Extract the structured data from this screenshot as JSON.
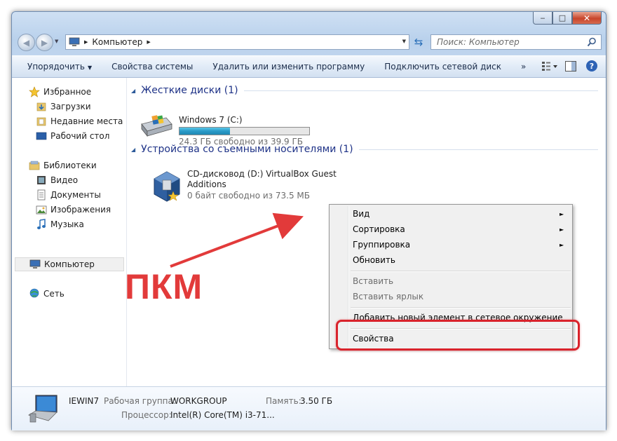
{
  "window": {
    "controls": {
      "minimize": "‒",
      "maximize": "□",
      "close": "✕"
    }
  },
  "navbar": {
    "address": "Компьютер",
    "search_placeholder": "Поиск: Компьютер"
  },
  "toolbar": {
    "organize": "Упорядочить",
    "system_properties": "Свойства системы",
    "uninstall": "Удалить или изменить программу",
    "map_drive": "Подключить сетевой диск",
    "more": "»"
  },
  "sidebar": {
    "favorites": {
      "label": "Избранное",
      "items": [
        "Загрузки",
        "Недавние места",
        "Рабочий стол"
      ]
    },
    "libraries": {
      "label": "Библиотеки",
      "items": [
        "Видео",
        "Документы",
        "Изображения",
        "Музыка"
      ]
    },
    "computer": "Компьютер",
    "network": "Сеть"
  },
  "main": {
    "hard_drives": {
      "header": "Жесткие диски (1)",
      "drive": {
        "name": "Windows 7 (C:)",
        "free": "24.3 ГБ свободно из 39.9 ГБ",
        "used_fraction": 0.39
      }
    },
    "removable": {
      "header": "Устройства со съемными носителями (1)",
      "drive": {
        "name_line1": "CD-дисковод (D:) VirtualBox Guest",
        "name_line2": "Additions",
        "free": "0 байт свободно из 73.5 МБ"
      }
    }
  },
  "context_menu": {
    "view": "Вид",
    "sort": "Сортировка",
    "group": "Группировка",
    "refresh": "Обновить",
    "paste": "Вставить",
    "paste_shortcut": "Вставить ярлык",
    "add_network": "Добавить новый элемент в сетевое окружение",
    "properties": "Свойства",
    "submenu_arrow": "►"
  },
  "annotation": {
    "label": "ПКМ",
    "color": "#e23a3a"
  },
  "details": {
    "computer_name": "IEWIN7",
    "workgroup_label": "Рабочая группа:",
    "workgroup": "WORKGROUP",
    "memory_label": "Память:",
    "memory": "3.50 ГБ",
    "cpu_label": "Процессор:",
    "cpu": "Intel(R) Core(TM) i3-71..."
  }
}
